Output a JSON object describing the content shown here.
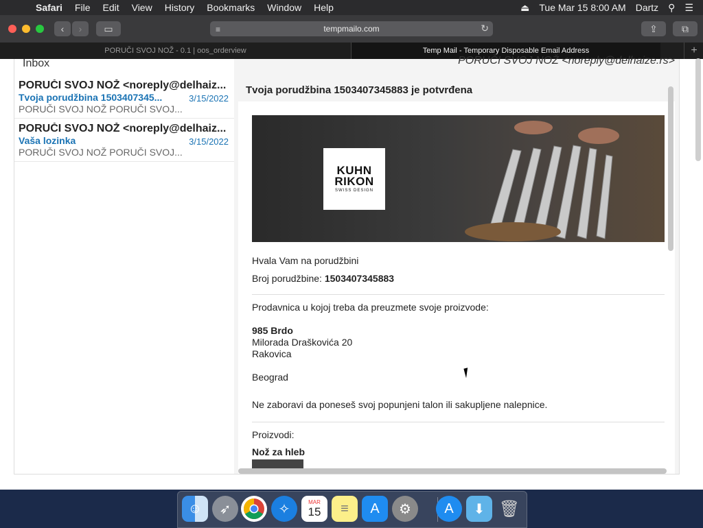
{
  "menubar": {
    "app": "Safari",
    "items": [
      "File",
      "Edit",
      "View",
      "History",
      "Bookmarks",
      "Window",
      "Help"
    ],
    "datetime": "Tue Mar 15  8:00 AM",
    "user": "Dartz"
  },
  "toolbar": {
    "url": "tempmailo.com"
  },
  "tabs": [
    {
      "label": "PORUČI SVOJ NOŽ - 0.1 | oos_orderview",
      "active": false
    },
    {
      "label": "Temp Mail - Temporary Disposable Email Address",
      "active": true
    }
  ],
  "inbox": {
    "title": "Inbox",
    "messages": [
      {
        "from": "PORUČI SVOJ NOŽ <noreply@delhaiz...",
        "subject": "Tvoja porudžbina 1503407345...",
        "date": "3/15/2022",
        "preview": "PORUČI SVOJ NOŽ PORUČI SVOJ..."
      },
      {
        "from": "PORUČI SVOJ NOŽ <noreply@delhaiz...",
        "subject": "Vaša lozinka",
        "date": "3/15/2022",
        "preview": "PORUČI SVOJ NOŽ PORUČI SVOJ..."
      }
    ]
  },
  "reader": {
    "sender": "PORUČI SVOJ NOŽ <noreply@delhaize.rs>",
    "subject": "Tvoja porudžbina 1503407345883 je potvrđena",
    "banner_logo_line1": "KUHN",
    "banner_logo_line2": "RIKON",
    "banner_logo_tagline": "SWISS DESIGN",
    "thanks": "Hvala Vam na porudžbini",
    "order_label": "Broj porudžbine:",
    "order_number": "1503407345883",
    "store_intro": "Prodavnica u kojoj treba da preuzmete svoje proizvode:",
    "store_name": "985 Brdo",
    "store_street": "Milorada Draškovića 20",
    "store_area": "Rakovica",
    "store_city": "Beograd",
    "reminder": "Ne zaboravi da poneseš svoj popunjeni talon ili sakupljene nalepnice.",
    "products_label": "Proizvodi:",
    "product_name": "Nož za hleb"
  },
  "dock": {
    "calendar_month": "MAR",
    "calendar_day": "15"
  }
}
